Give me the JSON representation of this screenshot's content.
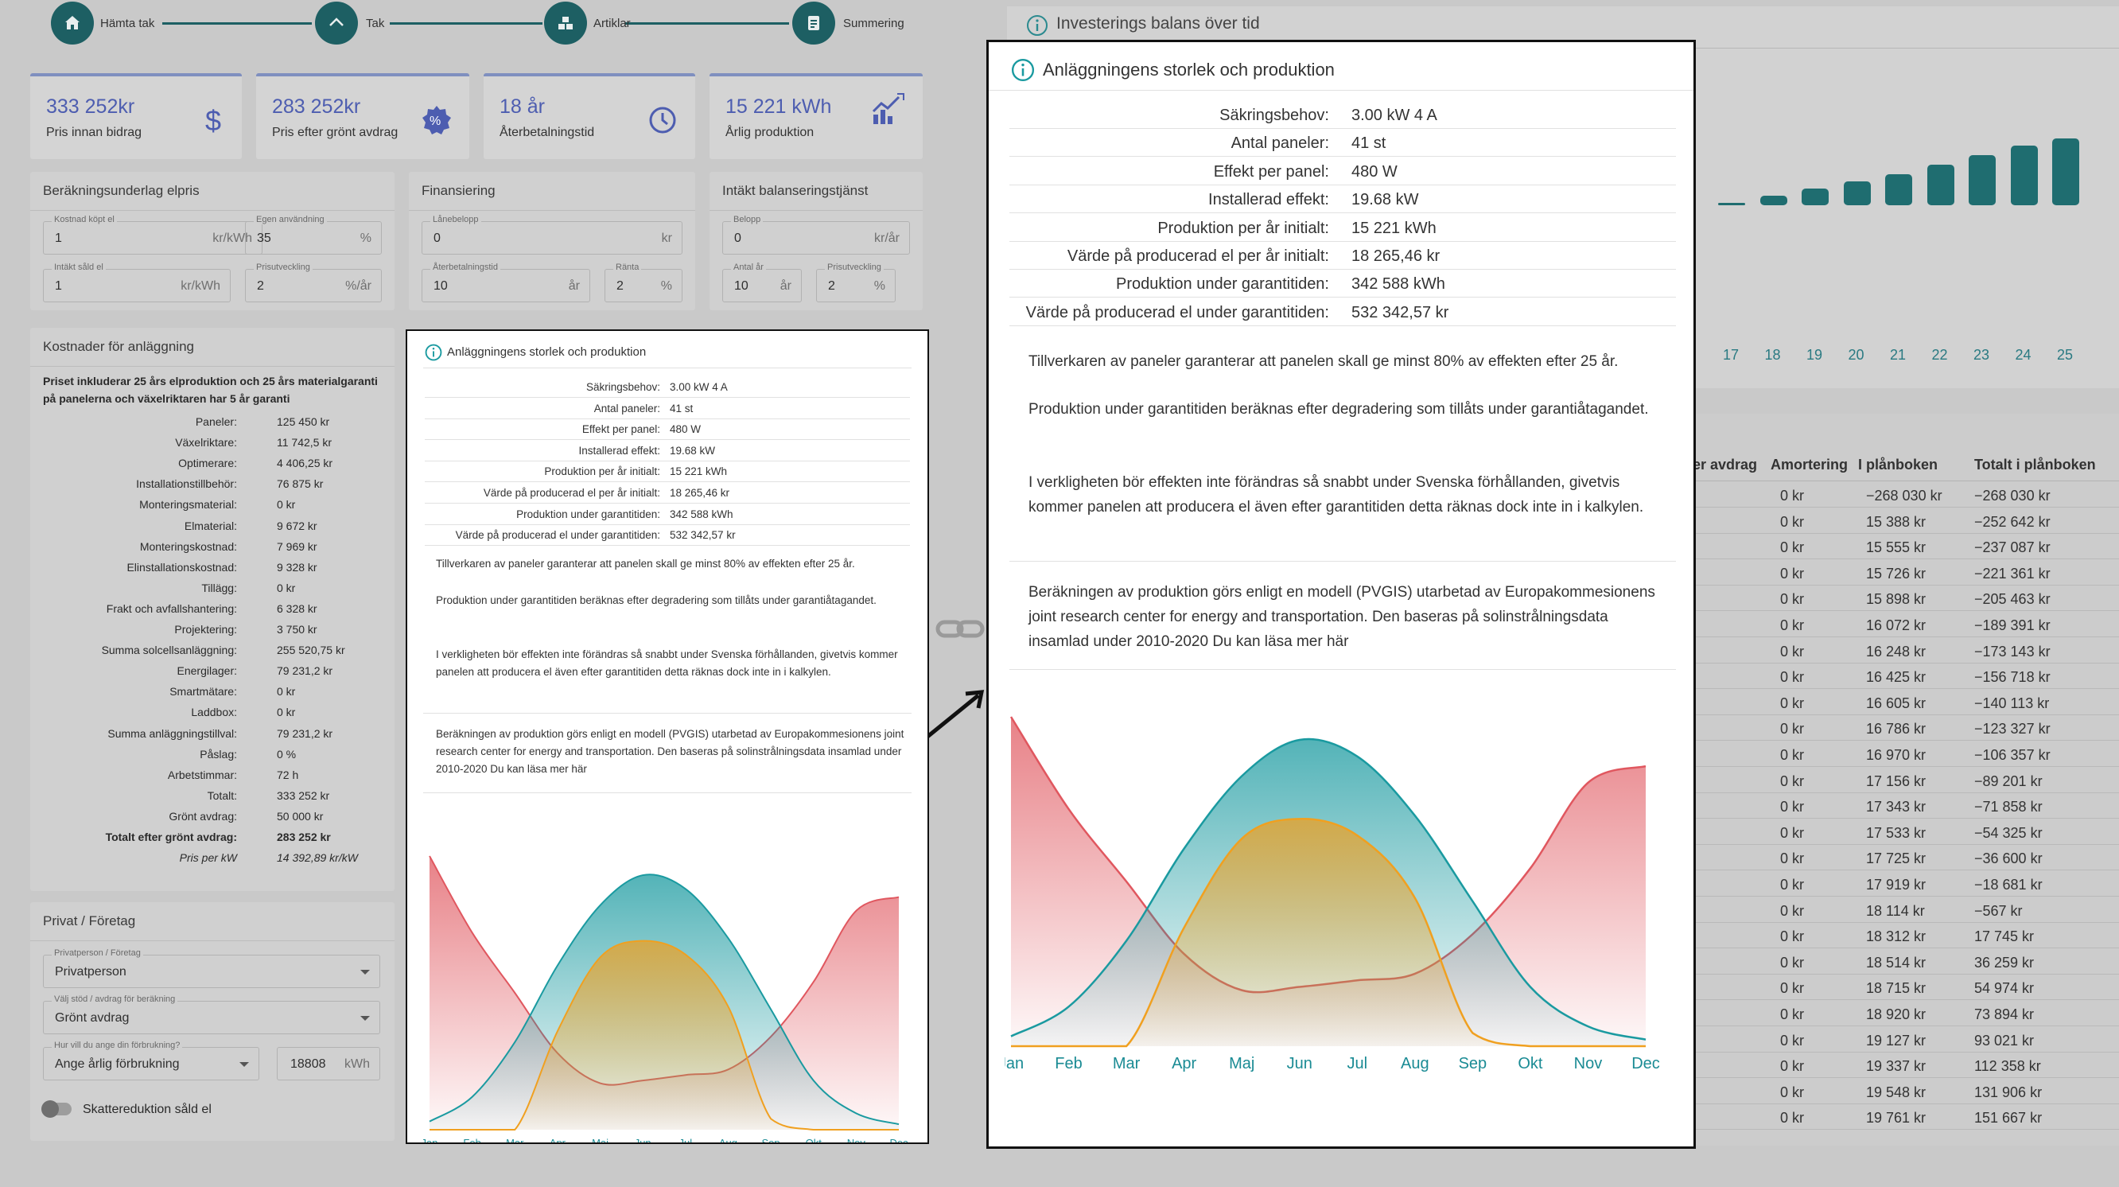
{
  "stepper": [
    {
      "label": "Hämta tak",
      "icon": "home-icon"
    },
    {
      "label": "Tak",
      "icon": "roof-icon"
    },
    {
      "label": "Artiklar",
      "icon": "boxes-icon"
    },
    {
      "label": "Summering",
      "icon": "document-icon"
    }
  ],
  "stats": [
    {
      "value": "333 252kr",
      "label": "Pris innan bidrag",
      "icon": "dollar-icon"
    },
    {
      "value": "283 252kr",
      "label": "Pris efter grönt avdrag",
      "icon": "percent-badge-icon"
    },
    {
      "value": "18 år",
      "label": "Återbetalningstid",
      "icon": "clock-history-icon"
    },
    {
      "value": "15 221 kWh",
      "label": "Årlig produktion",
      "icon": "production-chart-icon"
    }
  ],
  "calc": {
    "title": "Beräkningsunderlag elpris",
    "fields": [
      {
        "label": "Kostnad köpt el",
        "value": "1",
        "unit": "kr/kWh"
      },
      {
        "label": "Egen användning",
        "value": "35",
        "unit": "%"
      },
      {
        "label": "Intäkt såld el",
        "value": "1",
        "unit": "kr/kWh"
      },
      {
        "label": "Prisutveckling",
        "value": "2",
        "unit": "%/år"
      }
    ]
  },
  "financing": {
    "title": "Finansiering",
    "fields": [
      {
        "label": "Lånebelopp",
        "value": "0",
        "unit": "kr"
      },
      {
        "label": "Återbetalningstid",
        "value": "10",
        "unit": "år"
      },
      {
        "label": "Ränta",
        "value": "2",
        "unit": "%"
      }
    ]
  },
  "balancing": {
    "title": "Intäkt balanseringstjänst",
    "fields": [
      {
        "label": "Belopp",
        "value": "0",
        "unit": "kr/år"
      },
      {
        "label": "Antal år",
        "value": "10",
        "unit": "år"
      },
      {
        "label": "Prisutveckling",
        "value": "2",
        "unit": "%"
      }
    ]
  },
  "costs": {
    "title": "Kostnader för anläggning",
    "note": "Priset inkluderar 25 års elproduktion och 25 års materialgaranti på panelerna och växelriktaren har 5 år garanti",
    "rows": [
      {
        "label": "Paneler:",
        "value": "125 450 kr"
      },
      {
        "label": "Växelriktare:",
        "value": "11 742,5 kr"
      },
      {
        "label": "Optimerare:",
        "value": "4 406,25 kr"
      },
      {
        "label": "Installationstillbehör:",
        "value": "76 875 kr"
      },
      {
        "label": "Monteringsmaterial:",
        "value": "0 kr"
      },
      {
        "label": "Elmaterial:",
        "value": "9 672 kr"
      },
      {
        "label": "Monteringskostnad:",
        "value": "7 969 kr"
      },
      {
        "label": "Elinstallationskostnad:",
        "value": "9 328 kr"
      },
      {
        "label": "Tillägg:",
        "value": "0 kr"
      },
      {
        "label": "Frakt och avfallshantering:",
        "value": "6 328 kr"
      },
      {
        "label": "Projektering:",
        "value": "3 750 kr"
      },
      {
        "label": "Summa solcellsanläggning:",
        "value": "255 520,75 kr"
      },
      {
        "label": "Energilager:",
        "value": "79 231,2 kr"
      },
      {
        "label": "Smartmätare:",
        "value": "0 kr"
      },
      {
        "label": "Laddbox:",
        "value": "0 kr"
      },
      {
        "label": "Summa anläggningstillval:",
        "value": "79 231,2 kr"
      },
      {
        "label": "Påslag:",
        "value": "0 %"
      },
      {
        "label": "Arbetstimmar:",
        "value": "72 h"
      },
      {
        "label": "Totalt:",
        "value": "333 252 kr"
      },
      {
        "label": "Grönt avdrag:",
        "value": "50 000 kr"
      },
      {
        "label": "Totalt efter grönt avdrag:",
        "value": "283 252 kr"
      },
      {
        "label": "Pris per kW",
        "value": "14 392,89 kr/kW"
      }
    ]
  },
  "privat": {
    "title": "Privat / Företag",
    "type_label": "Privatperson / Företag",
    "type_value": "Privatperson",
    "support_label": "Välj stöd / avdrag för beräkning",
    "support_value": "Grönt avdrag",
    "consumption_label": "Hur vill du ange din förbrukning?",
    "consumption_value": "Ange årlig förbrukning",
    "consumption_amount": "18808",
    "consumption_unit": "kWh",
    "toggle_label": "Skattereduktion såld el"
  },
  "invest": {
    "title": "Investerings balans över tid",
    "years_visible": [
      "17",
      "18",
      "19",
      "20",
      "21",
      "22",
      "23",
      "24",
      "25"
    ],
    "bar_values_visible": [
      2,
      4,
      7,
      10,
      13,
      17,
      21,
      25,
      28
    ]
  },
  "table": {
    "headers": [
      "er avdrag",
      "Amortering",
      "I plånboken",
      "Totalt i plånboken"
    ],
    "rows": [
      [
        "0 kr",
        "−268 030 kr",
        "−268 030 kr"
      ],
      [
        "0 kr",
        "15 388 kr",
        "−252 642 kr"
      ],
      [
        "0 kr",
        "15 555 kr",
        "−237 087 kr"
      ],
      [
        "0 kr",
        "15 726 kr",
        "−221 361 kr"
      ],
      [
        "0 kr",
        "15 898 kr",
        "−205 463 kr"
      ],
      [
        "0 kr",
        "16 072 kr",
        "−189 391 kr"
      ],
      [
        "0 kr",
        "16 248 kr",
        "−173 143 kr"
      ],
      [
        "0 kr",
        "16 425 kr",
        "−156 718 kr"
      ],
      [
        "0 kr",
        "16 605 kr",
        "−140 113 kr"
      ],
      [
        "0 kr",
        "16 786 kr",
        "−123 327 kr"
      ],
      [
        "0 kr",
        "16 970 kr",
        "−106 357 kr"
      ],
      [
        "0 kr",
        "17 156 kr",
        "−89 201 kr"
      ],
      [
        "0 kr",
        "17 343 kr",
        "−71 858 kr"
      ],
      [
        "0 kr",
        "17 533 kr",
        "−54 325 kr"
      ],
      [
        "0 kr",
        "17 725 kr",
        "−36 600 kr"
      ],
      [
        "0 kr",
        "17 919 kr",
        "−18 681 kr"
      ],
      [
        "0 kr",
        "18 114 kr",
        "−567 kr"
      ],
      [
        "0 kr",
        "18 312 kr",
        "17 745 kr"
      ],
      [
        "0 kr",
        "18 514 kr",
        "36 259 kr"
      ],
      [
        "0 kr",
        "18 715 kr",
        "54 974 kr"
      ],
      [
        "0 kr",
        "18 920 kr",
        "73 894 kr"
      ],
      [
        "0 kr",
        "19 127 kr",
        "93 021 kr"
      ],
      [
        "0 kr",
        "19 337 kr",
        "112 358 kr"
      ],
      [
        "0 kr",
        "19 548 kr",
        "131 906 kr"
      ],
      [
        "0 kr",
        "19 761 kr",
        "151 667 kr"
      ]
    ]
  },
  "production_card": {
    "title": "Anläggningens storlek och produktion",
    "rows": [
      {
        "label": "Säkringsbehov:",
        "value": "3.00 kW 4 A"
      },
      {
        "label": "Antal paneler:",
        "value": "41 st"
      },
      {
        "label": "Effekt per panel:",
        "value": "480 W"
      },
      {
        "label": "Installerad effekt:",
        "value": "19.68 kW"
      },
      {
        "label": "Produktion per år initialt:",
        "value": "15 221 kWh"
      },
      {
        "label": "Värde på producerad el per år initialt:",
        "value": "18 265,46 kr"
      },
      {
        "label": "Produktion under garantitiden:",
        "value": "342 588 kWh"
      },
      {
        "label": "Värde på producerad el under garantitiden:",
        "value": "532 342,57 kr"
      }
    ],
    "para1": "Tillverkaren av paneler garanterar att panelen skall ge minst 80% av effekten efter 25 år.",
    "para2": "Produktion under garantitiden beräknas efter degradering som tillåts under garantiåtagandet.",
    "para3": "I verkligheten bör effekten inte förändras så snabbt under Svenska förhållanden, givetvis kommer panelen att producera el även efter garantitiden detta räknas dock inte in i kalkylen.",
    "para4": "Beräkningen av produktion görs enligt en modell (PVGIS) utarbetad av Europakommesionens joint research center for energy and transportation. Den baseras på solinstrålningsdata insamlad under 2010-2020 Du kan läsa mer här",
    "para4_large": "Beräkningen av produktion görs enligt en modell (PVGIS) utarbetad av Europakommesionens joint research center for energy and transportation. Den baseras på solinstrålningsdata insamlad under 2010-2020 Du kan läsa mer här"
  },
  "chart_data": {
    "type": "area",
    "categories": [
      "Jan",
      "Feb",
      "Mar",
      "Apr",
      "Maj",
      "Jun",
      "Jul",
      "Aug",
      "Sep",
      "Okt",
      "Nov",
      "Dec"
    ],
    "series": [
      {
        "color": "#e0575f",
        "values": [
          1.0,
          0.72,
          0.5,
          0.28,
          0.17,
          0.18,
          0.2,
          0.22,
          0.34,
          0.54,
          0.8,
          0.85
        ]
      },
      {
        "color": "#1a9aa0",
        "values": [
          0.03,
          0.12,
          0.32,
          0.6,
          0.82,
          0.93,
          0.88,
          0.7,
          0.44,
          0.18,
          0.06,
          0.02
        ]
      },
      {
        "color": "#f0a020",
        "values": [
          0.0,
          0.0,
          0.0,
          0.36,
          0.63,
          0.69,
          0.64,
          0.45,
          0.04,
          0.0,
          0.0,
          0.0
        ]
      }
    ]
  },
  "colors": {
    "accent": "#1d5f63",
    "stat_value": "#4d5db0",
    "chart_teal": "#1a9aa0",
    "chart_red": "#e0575f",
    "chart_orange": "#f0a020",
    "month_text": "#1a8b94"
  }
}
